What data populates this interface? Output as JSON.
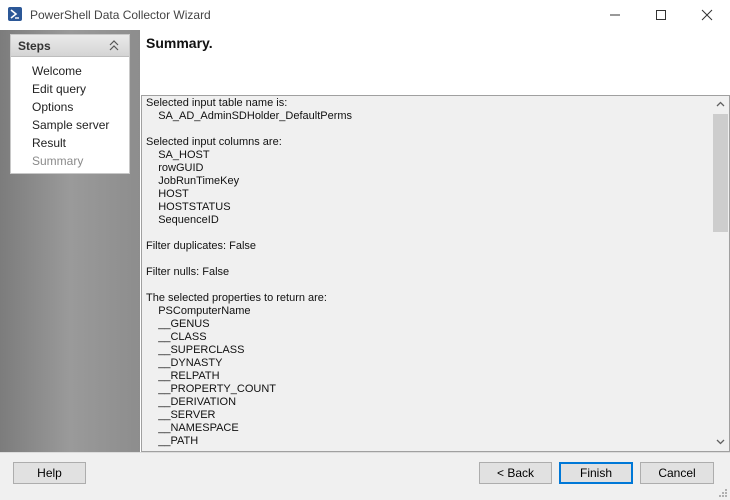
{
  "window": {
    "title": "PowerShell Data Collector Wizard",
    "icon": "powershell-icon"
  },
  "sidebar": {
    "title": "Steps",
    "steps": [
      {
        "label": "Welcome",
        "current": false
      },
      {
        "label": "Edit query",
        "current": false
      },
      {
        "label": "Options",
        "current": false
      },
      {
        "label": "Sample server",
        "current": false
      },
      {
        "label": "Result",
        "current": false
      },
      {
        "label": "Summary",
        "current": true
      }
    ]
  },
  "page": {
    "title": "Summary."
  },
  "summary": {
    "lines": [
      "Selected input table name is:",
      "    SA_AD_AdminSDHolder_DefaultPerms",
      "",
      "Selected input columns are:",
      "    SA_HOST",
      "    rowGUID",
      "    JobRunTimeKey",
      "    HOST",
      "    HOSTSTATUS",
      "    SequenceID",
      "",
      "Filter duplicates: False",
      "",
      "Filter nulls: False",
      "",
      "The selected properties to return are:",
      "    PSComputerName",
      "    __GENUS",
      "    __CLASS",
      "    __SUPERCLASS",
      "    __DYNASTY",
      "    __RELPATH",
      "    __PROPERTY_COUNT",
      "    __DERIVATION",
      "    __SERVER",
      "    __NAMESPACE",
      "    __PATH"
    ]
  },
  "footer": {
    "help": "Help",
    "back": "< Back",
    "finish": "Finish",
    "cancel": "Cancel"
  },
  "colors": {
    "accent": "#0078d7",
    "sidebar": "#8d8d8d"
  }
}
